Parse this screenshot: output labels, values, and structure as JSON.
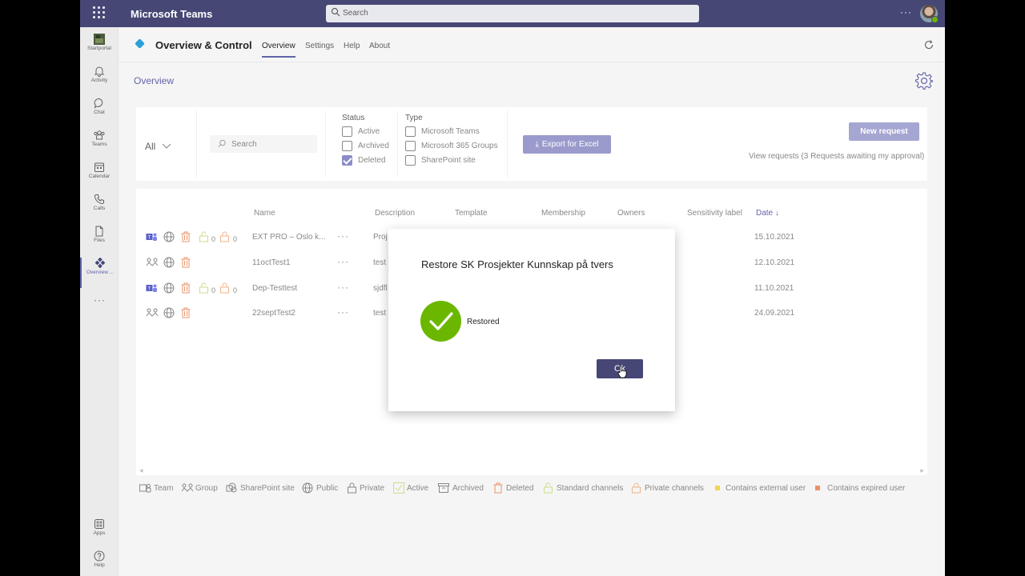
{
  "window": {
    "app_name": "Microsoft Teams",
    "search_placeholder": "Search",
    "more": "···"
  },
  "rail": {
    "items": [
      {
        "label": "Startportal",
        "icon": "startportal-icon"
      },
      {
        "label": "Activity",
        "icon": "bell-icon"
      },
      {
        "label": "Chat",
        "icon": "chat-icon"
      },
      {
        "label": "Teams",
        "icon": "teams-icon"
      },
      {
        "label": "Calendar",
        "icon": "calendar-icon"
      },
      {
        "label": "Calls",
        "icon": "phone-icon"
      },
      {
        "label": "Files",
        "icon": "file-icon"
      },
      {
        "label": "Overview ...",
        "icon": "overview-icon"
      }
    ],
    "more": "···",
    "bottom": [
      {
        "label": "Apps",
        "icon": "apps-icon"
      },
      {
        "label": "Help",
        "icon": "help-icon"
      }
    ]
  },
  "app": {
    "title": "Overview & Control",
    "tabs": [
      "Overview",
      "Settings",
      "Help",
      "About"
    ],
    "active_tab": "Overview",
    "page_title": "Overview"
  },
  "filters": {
    "scope": "All",
    "search_placeholder": "Search",
    "status_title": "Status",
    "status": [
      {
        "label": "Active",
        "checked": false
      },
      {
        "label": "Archived",
        "checked": false
      },
      {
        "label": "Deleted",
        "checked": true
      }
    ],
    "type_title": "Type",
    "type": [
      {
        "label": "Microsoft Teams",
        "checked": false
      },
      {
        "label": "Microsoft 365 Groups",
        "checked": false
      },
      {
        "label": "SharePoint site",
        "checked": false
      }
    ],
    "export_label": "Export for Excel",
    "new_request_label": "New request",
    "view_requests": "View requests (3 Requests awaiting my approval)"
  },
  "table": {
    "columns": [
      "Name",
      "Description",
      "Template",
      "Membership",
      "Owners",
      "Sensitivity label",
      "Date ↓"
    ],
    "rows": [
      {
        "kind": "team",
        "channels": true,
        "std_count": "0",
        "priv_count": "0",
        "name": "EXT PRO – Oslo k...",
        "more": "···",
        "description": "Proj",
        "date": "15.10.2021"
      },
      {
        "kind": "group",
        "channels": false,
        "name": "11octTest1",
        "more": "···",
        "description": "test",
        "date": "12.10.2021"
      },
      {
        "kind": "team",
        "channels": true,
        "std_count": "0",
        "priv_count": "0",
        "name": "Dep-Testtest",
        "more": "···",
        "description": "sjdfl",
        "date": "11.10.2021"
      },
      {
        "kind": "group",
        "channels": false,
        "name": "22septTest2",
        "more": "···",
        "description": "test",
        "date": "24.09.2021"
      }
    ]
  },
  "legend": [
    "Team",
    "Group",
    "SharePoint site",
    "Public",
    "Private",
    "Active",
    "Archived",
    "Deleted",
    "Standard channels",
    "Private channels",
    "Contains external user",
    "Contains expired user"
  ],
  "colors": {
    "brand": "#464775",
    "accent": "#6264a7",
    "success": "#6bb700",
    "deleted": "#e8956b",
    "channels": "#c9e08a",
    "private_channels": "#f0b48a",
    "external_user": "#f5d350",
    "expired_user": "#f0906a"
  },
  "dialog": {
    "title": "Restore SK Prosjekter Kunnskap på tvers",
    "status": "Restored",
    "ok_label": "Ok"
  }
}
